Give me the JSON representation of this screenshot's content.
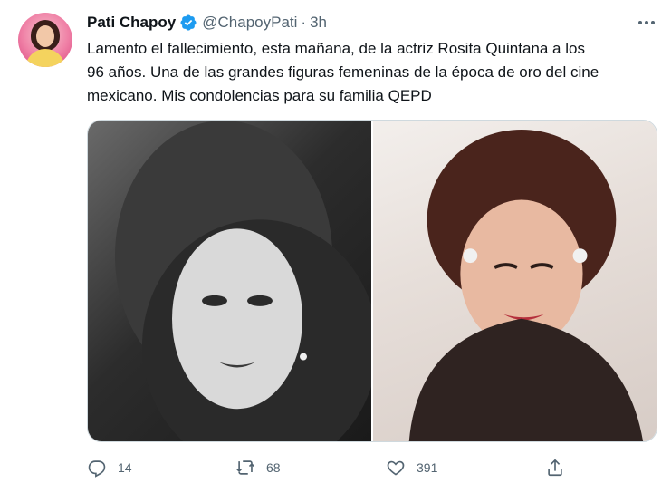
{
  "author": {
    "name": "Pati Chapoy",
    "handle": "@ChapoyPati",
    "separator": "·",
    "time": "3h",
    "verified": true
  },
  "tweet": {
    "lines": [
      "Lamento el fallecimiento, esta mañana, de la actriz Rosita Quintana a los",
      "96 años. Una de las grandes figuras femeninas de la época de oro del cine",
      "mexicano. Mis condolencias para su familia QEPD"
    ]
  },
  "media": [
    {
      "kind": "photo",
      "style": "black-and-white portrait"
    },
    {
      "kind": "photo",
      "style": "color portrait"
    }
  ],
  "actions": {
    "reply": {
      "icon": "reply-icon",
      "count": "14"
    },
    "retweet": {
      "icon": "retweet-icon",
      "count": "68"
    },
    "like": {
      "icon": "heart-icon",
      "count": "391"
    },
    "share": {
      "icon": "share-icon"
    }
  },
  "colors": {
    "text": "#0f1419",
    "secondary": "#536471",
    "verified": "#1d9bf0",
    "border": "#cfd9de"
  }
}
